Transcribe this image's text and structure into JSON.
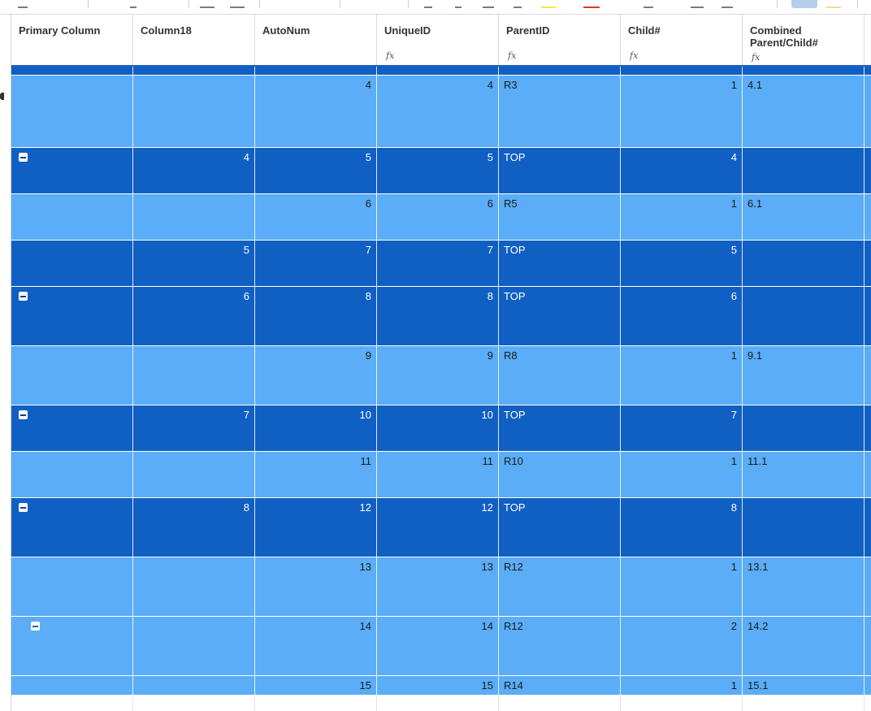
{
  "columns": [
    {
      "id": "primary",
      "label": "Primary Column",
      "formula": false
    },
    {
      "id": "column18",
      "label": "Column18",
      "formula": false
    },
    {
      "id": "autonum",
      "label": "AutoNum",
      "formula": false
    },
    {
      "id": "uniqueid",
      "label": "UniqueID",
      "formula": true
    },
    {
      "id": "parentid",
      "label": "ParentID",
      "formula": true
    },
    {
      "id": "child",
      "label": "Child#",
      "formula": true
    },
    {
      "id": "combined",
      "label": "Combined Parent/Child#",
      "formula": true
    }
  ],
  "formula_icon": "fx",
  "rows": [
    {
      "type": "parent",
      "collapse": false,
      "column18": "",
      "autonum": "",
      "uniqueid": "",
      "parentid": "",
      "child": "",
      "combined": ""
    },
    {
      "type": "child",
      "collapse": false,
      "column18": "",
      "autonum": "4",
      "uniqueid": "4",
      "parentid": "R3",
      "child": "1",
      "combined": "4.1"
    },
    {
      "type": "parent",
      "collapse": true,
      "column18": "4",
      "autonum": "5",
      "uniqueid": "5",
      "parentid": "TOP",
      "child": "4",
      "combined": ""
    },
    {
      "type": "child",
      "collapse": false,
      "column18": "",
      "autonum": "6",
      "uniqueid": "6",
      "parentid": "R5",
      "child": "1",
      "combined": "6.1"
    },
    {
      "type": "parent",
      "collapse": false,
      "column18": "5",
      "autonum": "7",
      "uniqueid": "7",
      "parentid": "TOP",
      "child": "5",
      "combined": ""
    },
    {
      "type": "parent",
      "collapse": true,
      "column18": "6",
      "autonum": "8",
      "uniqueid": "8",
      "parentid": "TOP",
      "child": "6",
      "combined": ""
    },
    {
      "type": "child",
      "collapse": false,
      "column18": "",
      "autonum": "9",
      "uniqueid": "9",
      "parentid": "R8",
      "child": "1",
      "combined": "9.1"
    },
    {
      "type": "parent",
      "collapse": true,
      "column18": "7",
      "autonum": "10",
      "uniqueid": "10",
      "parentid": "TOP",
      "child": "7",
      "combined": ""
    },
    {
      "type": "child",
      "collapse": false,
      "column18": "",
      "autonum": "11",
      "uniqueid": "11",
      "parentid": "R10",
      "child": "1",
      "combined": "11.1"
    },
    {
      "type": "parent",
      "collapse": true,
      "column18": "8",
      "autonum": "12",
      "uniqueid": "12",
      "parentid": "TOP",
      "child": "8",
      "combined": ""
    },
    {
      "type": "child",
      "collapse": false,
      "column18": "",
      "autonum": "13",
      "uniqueid": "13",
      "parentid": "R12",
      "child": "1",
      "combined": "13.1"
    },
    {
      "type": "child",
      "collapse": true,
      "indent": true,
      "column18": "",
      "autonum": "14",
      "uniqueid": "14",
      "parentid": "R12",
      "child": "2",
      "combined": "14.2"
    },
    {
      "type": "child",
      "collapse": false,
      "column18": "",
      "autonum": "15",
      "uniqueid": "15",
      "parentid": "R14",
      "child": "1",
      "combined": "15.1"
    }
  ],
  "colors": {
    "parent_row": "#1060c4",
    "child_row": "#5aadf6",
    "header_border": "#1f5fbf",
    "toolbar_highlight": "#b5cdea"
  }
}
